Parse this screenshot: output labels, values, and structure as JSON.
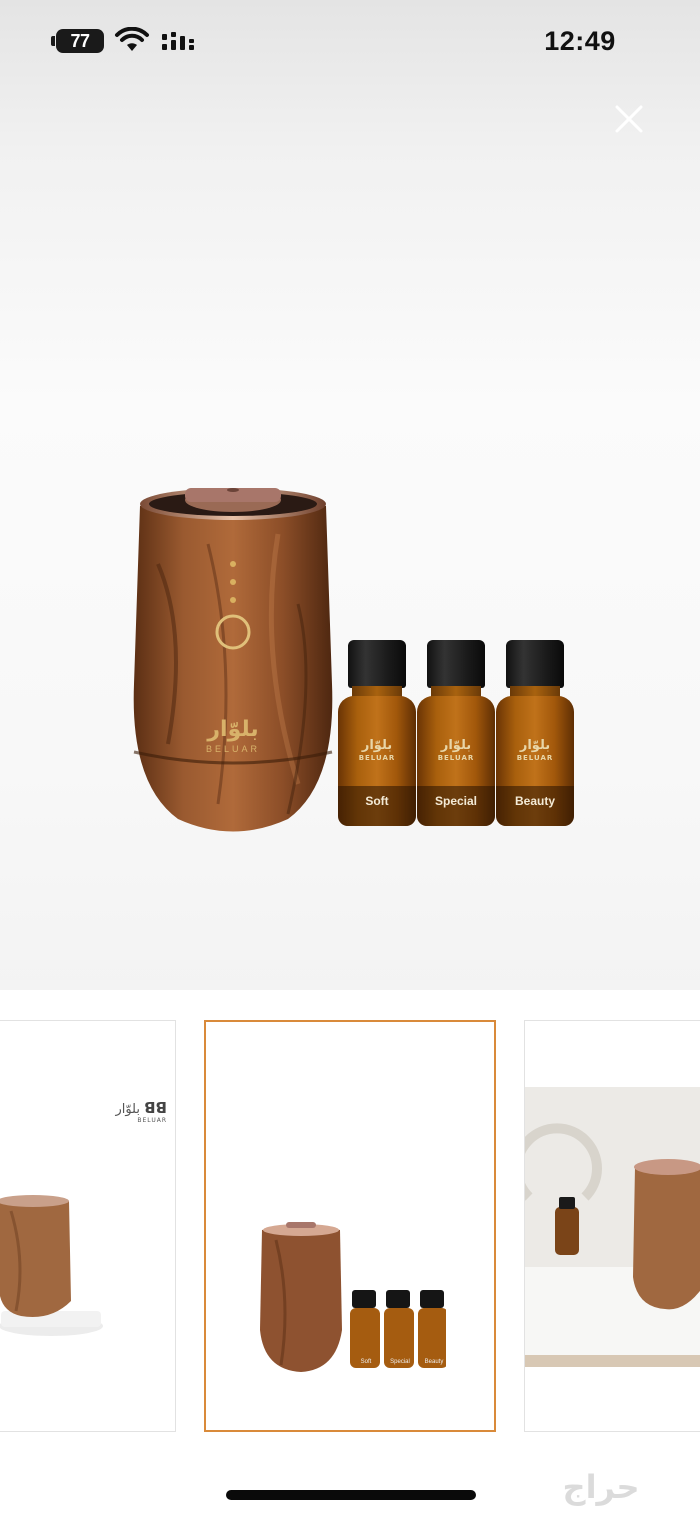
{
  "status_bar": {
    "battery": "77",
    "time": "12:49",
    "wifi_icon": "wifi-icon",
    "signal_icon": "signal-icon"
  },
  "viewer": {
    "close_icon": "close-icon",
    "product": {
      "brand_arabic": "بلوّار",
      "brand_latin": "BELUAR",
      "bottle_labels": [
        "Soft",
        "Special",
        "Beauty"
      ]
    }
  },
  "thumbnails": {
    "selected_index": 1,
    "items": [
      {
        "brand_arabic": "بلوّار",
        "brand_latin": "BELUAR"
      },
      {
        "bottle_labels": [
          "Soft",
          "Special",
          "Beauty"
        ]
      },
      {}
    ],
    "accent_color": "#d98a3a"
  },
  "watermark": {
    "text": "حراج"
  }
}
